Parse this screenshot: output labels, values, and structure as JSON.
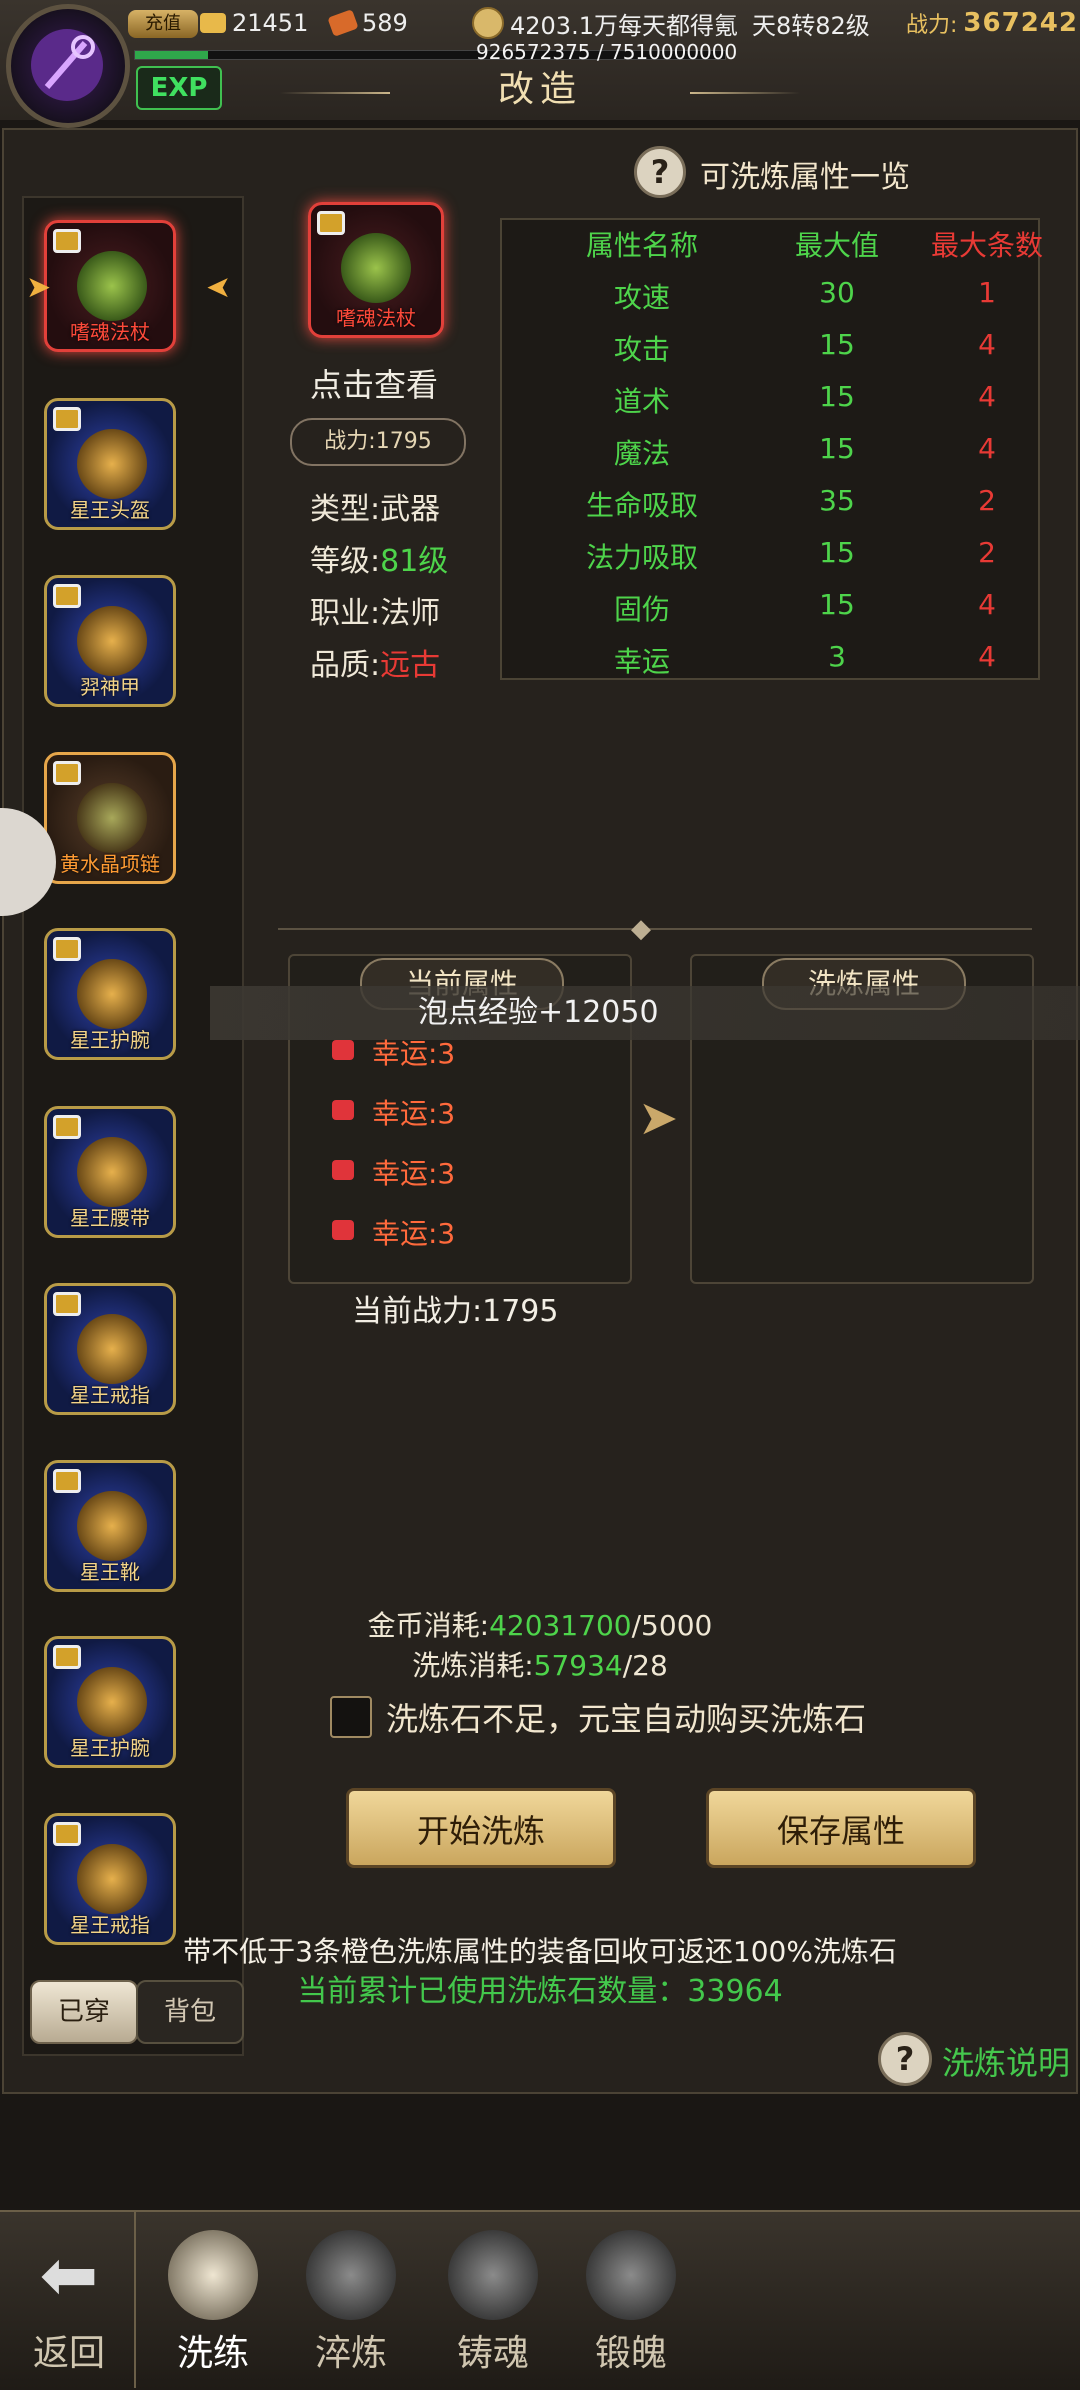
{
  "topbar": {
    "vip_label": "充值",
    "ingots": "21451",
    "tickets": "589",
    "coin_msg": "4203.1万每天都得氪",
    "level": "天8转82级",
    "power_label": "战力:",
    "power_value": "367242",
    "exp_text": "926572375 / 7510000000",
    "exp_badge": "EXP",
    "exp_fraction": 0.123
  },
  "title": "改造",
  "attr_list": {
    "title": "可洗炼属性一览",
    "headers": [
      "属性名称",
      "最大值",
      "最大条数"
    ],
    "rows": [
      [
        "攻速",
        "30",
        "1"
      ],
      [
        "攻击",
        "15",
        "4"
      ],
      [
        "道术",
        "15",
        "4"
      ],
      [
        "魔法",
        "15",
        "4"
      ],
      [
        "生命吸取",
        "35",
        "2"
      ],
      [
        "法力吸取",
        "15",
        "2"
      ],
      [
        "固伤",
        "15",
        "4"
      ],
      [
        "幸运",
        "3",
        "4"
      ]
    ]
  },
  "equipment": [
    {
      "label": "嗜魂法杖"
    },
    {
      "label": "星王头盔"
    },
    {
      "label": "羿神甲"
    },
    {
      "label": "黄水晶项链"
    },
    {
      "label": "星王护腕"
    },
    {
      "label": "星王腰带"
    },
    {
      "label": "星王戒指"
    },
    {
      "label": "星王靴"
    },
    {
      "label": "星王护腕"
    },
    {
      "label": "星王戒指"
    }
  ],
  "tabs": {
    "worn": "已穿",
    "bag": "背包"
  },
  "item": {
    "name": "嗜魂法杖",
    "click_view": "点击查看",
    "power": "战力:1795",
    "type_label": "类型:",
    "type": "武器",
    "level_label": "等级:",
    "level": "81级",
    "job_label": "职业:",
    "job": "法师",
    "quality_label": "品质:",
    "quality": "远古"
  },
  "current_attr_title": "当前属性",
  "refine_attr_title": "洗炼属性",
  "banner": "泡点经验+12050",
  "current_attrs": [
    "幸运:3",
    "幸运:3",
    "幸运:3",
    "幸运:3"
  ],
  "current_power": "当前战力:1795",
  "gold_cost": {
    "label": "金币消耗:",
    "have": "42031700",
    "need": "/5000"
  },
  "refine_cost": {
    "label": "洗炼消耗:",
    "have": "57934",
    "need": "/28"
  },
  "auto_buy": "洗炼石不足，元宝自动购买洗炼石",
  "buttons": {
    "start": "开始洗炼",
    "save": "保存属性"
  },
  "note1": "带不低于3条橙色洗炼属性的装备回收可返还100%洗炼石",
  "note2": "当前累计已使用洗炼石数量：33964",
  "help_link": "洗炼说明",
  "nav": {
    "back": "返回",
    "items": [
      "洗练",
      "淬炼",
      "铸魂",
      "锻魄"
    ]
  }
}
